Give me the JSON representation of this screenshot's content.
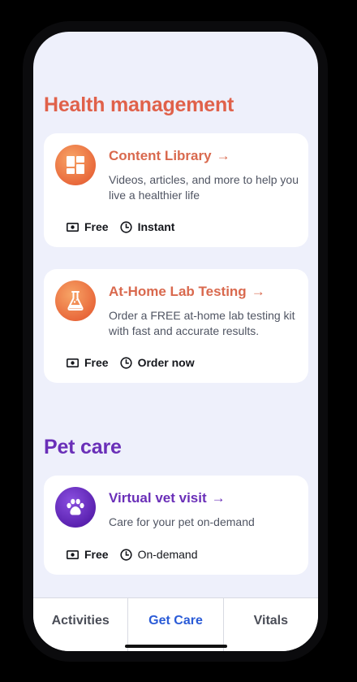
{
  "colors": {
    "health_accent": "#e0614a",
    "pet_accent": "#6a2fb8",
    "active_tab": "#2a5bd7",
    "background": "#eef0fb"
  },
  "health": {
    "title": "Health management",
    "cards": [
      {
        "icon": "grid-icon",
        "title": "Content Library",
        "arrow": "→",
        "description": "Videos, articles, and more to help you live a healthier life",
        "price": "Free",
        "timing": "Instant"
      },
      {
        "icon": "flask-icon",
        "title": "At-Home Lab Testing",
        "arrow": "→",
        "description": "Order a FREE at-home lab testing kit with fast and accurate results.",
        "price": "Free",
        "timing": "Order now"
      }
    ]
  },
  "pet": {
    "title": "Pet care",
    "cards": [
      {
        "icon": "paw-icon",
        "title": "Virtual vet visit",
        "arrow": "→",
        "description": "Care for your pet on-demand",
        "price": "Free",
        "timing": "On-demand"
      }
    ]
  },
  "tabs": [
    {
      "label": "Activities",
      "active": false
    },
    {
      "label": "Get Care",
      "active": true
    },
    {
      "label": "Vitals",
      "active": false
    }
  ]
}
